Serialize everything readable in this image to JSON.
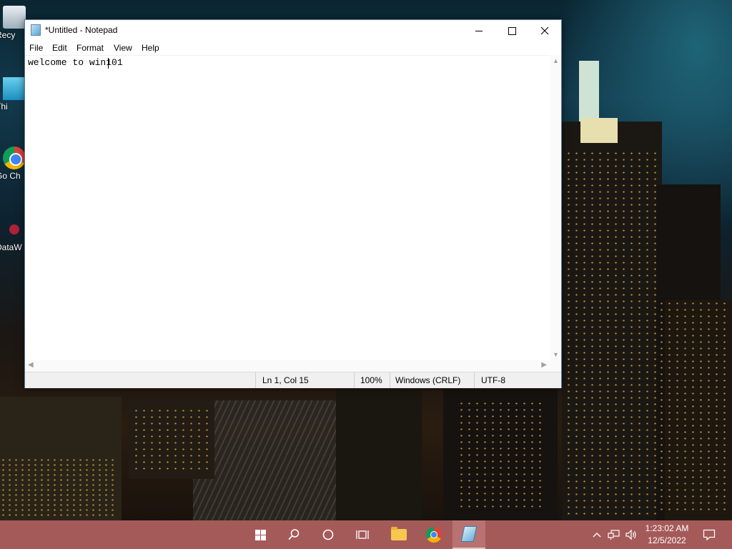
{
  "desktop": {
    "icons": [
      {
        "label": "Recy",
        "icon": "recycle-bin-icon"
      },
      {
        "label": "Thi",
        "icon": "this-pc-icon"
      },
      {
        "label": "Go Ch",
        "icon": "google-chrome-icon"
      },
      {
        "label": "DataW",
        "icon": "datawrapper-icon"
      }
    ]
  },
  "notepad": {
    "title": "*Untitled - Notepad",
    "menu": [
      "File",
      "Edit",
      "Format",
      "View",
      "Help"
    ],
    "content": "welcome to win101",
    "status": {
      "position": "Ln 1, Col 15",
      "zoom": "100%",
      "line_endings": "Windows (CRLF)",
      "encoding": "UTF-8"
    }
  },
  "taskbar": {
    "pinned": [
      "start-icon",
      "search-icon",
      "cortana-icon",
      "task-view-icon",
      "file-explorer-icon",
      "chrome-icon",
      "notepad-icon"
    ],
    "clock": {
      "time": "1:23:02 AM",
      "date": "12/5/2022"
    },
    "accent_color": "#a55a5a"
  }
}
